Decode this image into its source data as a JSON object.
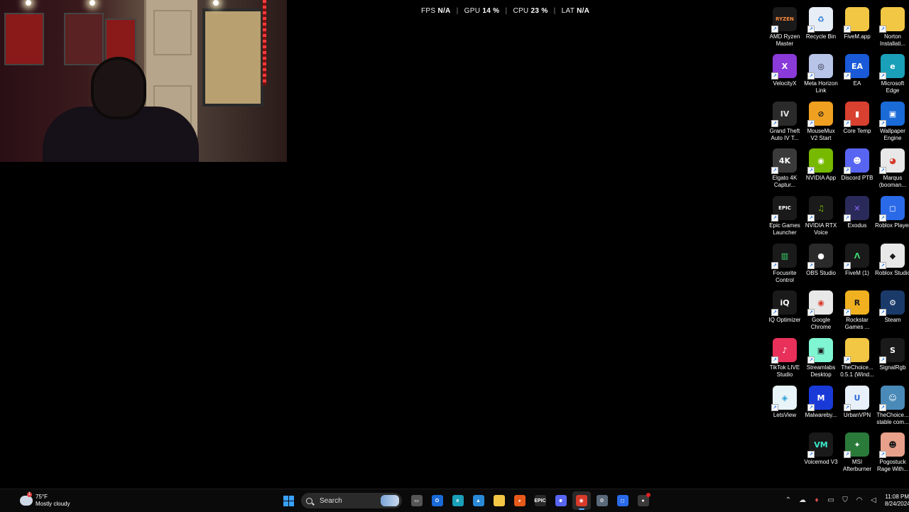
{
  "overlay": {
    "fps_label": "FPS",
    "fps_value": "N/A",
    "gpu_label": "GPU",
    "gpu_value": "14 %",
    "cpu_label": "CPU",
    "cpu_value": "23 %",
    "lat_label": "LAT",
    "lat_value": "N/A",
    "separator": "|"
  },
  "desktop": {
    "icons": [
      {
        "label": "AMD Ryzen Master",
        "glyph": "RYZEN",
        "bg": "#1a1a1a",
        "fg": "#ff8a3a"
      },
      {
        "label": "Recycle Bin",
        "glyph": "♻",
        "bg": "#e8eef6",
        "fg": "#2a7ad8"
      },
      {
        "label": "FiveM.app",
        "glyph": "",
        "bg": "#f2c744",
        "fg": "#ffffff"
      },
      {
        "label": "Norton Installati...",
        "glyph": "",
        "bg": "#f2c744",
        "fg": "#ffffff"
      },
      {
        "label": "VelocityX",
        "glyph": "X",
        "bg": "#8a3ad8",
        "fg": "#ffffff"
      },
      {
        "label": "Meta Horizon Link",
        "glyph": "◎",
        "bg": "#b8c4e8",
        "fg": "#1a1a2a"
      },
      {
        "label": "EA",
        "glyph": "EA",
        "bg": "#1a5ad8",
        "fg": "#ffffff"
      },
      {
        "label": "Microsoft Edge",
        "glyph": "e",
        "bg": "#1aa0b8",
        "fg": "#ffffff"
      },
      {
        "label": "Grand Theft Auto IV T...",
        "glyph": "IV",
        "bg": "#2a2a2a",
        "fg": "#dddddd"
      },
      {
        "label": "MouseMux V2 Start",
        "glyph": "⊘",
        "bg": "#f0a020",
        "fg": "#1a1a1a"
      },
      {
        "label": "Core Temp",
        "glyph": "▮",
        "bg": "#d84030",
        "fg": "#ffffff"
      },
      {
        "label": "Wallpaper Engine",
        "glyph": "▣",
        "bg": "#1a6ad8",
        "fg": "#ffffff"
      },
      {
        "label": "Elgato 4K Captur...",
        "glyph": "4K",
        "bg": "#3a3a3a",
        "fg": "#ffffff"
      },
      {
        "label": "NVIDIA App",
        "glyph": "◉",
        "bg": "#76b900",
        "fg": "#ffffff"
      },
      {
        "label": "Discord PTB",
        "glyph": "☻",
        "bg": "#5865f2",
        "fg": "#ffffff"
      },
      {
        "label": "Marqus (booman...",
        "glyph": "◕",
        "bg": "#e8e8e8",
        "fg": "#d83a2a"
      },
      {
        "label": "Epic Games Launcher",
        "glyph": "EPIC",
        "bg": "#1a1a1a",
        "fg": "#ffffff"
      },
      {
        "label": "NVIDIA RTX Voice",
        "glyph": "♫",
        "bg": "#1a1a1a",
        "fg": "#76b900"
      },
      {
        "label": "Exodus",
        "glyph": "✕",
        "bg": "#2a2a5a",
        "fg": "#8a6aff"
      },
      {
        "label": "Roblox Player",
        "glyph": "◻",
        "bg": "#2a6ae8",
        "fg": "#ffffff"
      },
      {
        "label": "Focusrite Control",
        "glyph": "▥",
        "bg": "#1a1a1a",
        "fg": "#3ad870"
      },
      {
        "label": "OBS Studio",
        "glyph": "●",
        "bg": "#2a2a2a",
        "fg": "#ffffff"
      },
      {
        "label": "FiveM (1)",
        "glyph": "Λ",
        "bg": "#1a1a1a",
        "fg": "#3ad870"
      },
      {
        "label": "Roblox Studio",
        "glyph": "◆",
        "bg": "#e8e8e8",
        "fg": "#1a1a1a"
      },
      {
        "label": "IQ Optimizer",
        "glyph": "iQ",
        "bg": "#1a1a1a",
        "fg": "#ffffff"
      },
      {
        "label": "Google Chrome",
        "glyph": "◉",
        "bg": "#e8e8e8",
        "fg": "#d83a2a"
      },
      {
        "label": "Rockstar Games ...",
        "glyph": "R",
        "bg": "#f0b020",
        "fg": "#1a1a1a"
      },
      {
        "label": "Steam",
        "glyph": "⚙",
        "bg": "#1a3a6a",
        "fg": "#ffffff"
      },
      {
        "label": "TikTok LIVE Studio",
        "glyph": "♪",
        "bg": "#e8305a",
        "fg": "#ffffff"
      },
      {
        "label": "Streamlabs Desktop",
        "glyph": "▣",
        "bg": "#80f5d2",
        "fg": "#1a1a1a"
      },
      {
        "label": "TheChoice... 0.5.1 (Wind...",
        "glyph": "",
        "bg": "#f2c744",
        "fg": "#ffffff"
      },
      {
        "label": "SignalRgb",
        "glyph": "S",
        "bg": "#1a1a1a",
        "fg": "#ffffff"
      },
      {
        "label": "LetsView",
        "glyph": "◈",
        "bg": "#e8f4f8",
        "fg": "#2aa0d8"
      },
      {
        "label": "Malwareby...",
        "glyph": "M",
        "bg": "#1a3ad8",
        "fg": "#ffffff"
      },
      {
        "label": "UrbanVPN",
        "glyph": "U",
        "bg": "#e8f0fa",
        "fg": "#2a6ad8"
      },
      {
        "label": "TheChoice... stable com...",
        "glyph": "☺",
        "bg": "#4a8ab8",
        "fg": "#ffffff"
      },
      {
        "label": "Voicemod V3",
        "glyph": "VM",
        "bg": "#1a1a1a",
        "fg": "#3ae8c8"
      },
      {
        "label": "MSI Afterburner",
        "glyph": "✦",
        "bg": "#2a7a3a",
        "fg": "#ffffff"
      },
      {
        "label": "Pogostuck Rage With...",
        "glyph": "☻",
        "bg": "#e8a08a",
        "fg": "#1a1a1a"
      }
    ]
  },
  "taskbar": {
    "weather_temp": "75°F",
    "weather_desc": "Mostly cloudy",
    "search_label": "Search",
    "apps": [
      {
        "name": "file-explorer-app",
        "glyph": "▭",
        "bg": "#555555",
        "active": false
      },
      {
        "name": "outlook-app",
        "glyph": "O",
        "bg": "#1a6ad8",
        "active": false
      },
      {
        "name": "edge-app",
        "glyph": "e",
        "bg": "#1aa0b8",
        "active": false
      },
      {
        "name": "photos-app",
        "glyph": "▲",
        "bg": "#2a8ad8",
        "active": false
      },
      {
        "name": "folder-app",
        "glyph": "",
        "bg": "#f2c744",
        "active": false
      },
      {
        "name": "firefox-app",
        "glyph": "◕",
        "bg": "#e85a1a",
        "active": false
      },
      {
        "name": "epic-games-app",
        "glyph": "EPIC",
        "bg": "#2a2a2a",
        "active": false
      },
      {
        "name": "discord-app",
        "glyph": "☻",
        "bg": "#5865f2",
        "active": false
      },
      {
        "name": "chrome-app",
        "glyph": "◉",
        "bg": "#d83a2a",
        "active": true
      },
      {
        "name": "settings-app",
        "glyph": "⚙",
        "bg": "#5a6a7a",
        "active": false
      },
      {
        "name": "roblox-app",
        "glyph": "◻",
        "bg": "#2a6ae8",
        "active": false
      },
      {
        "name": "obs-app",
        "glyph": "●",
        "bg": "#3a3a3a",
        "active": false,
        "notify": true
      }
    ],
    "tray_icons": [
      "chevron-up-icon",
      "network-drive-icon",
      "microphone-icon",
      "keyboard-icon",
      "vpn-shield-icon",
      "wifi-icon",
      "volume-icon"
    ],
    "time": "11:08 PM",
    "date": "8/24/2024"
  }
}
